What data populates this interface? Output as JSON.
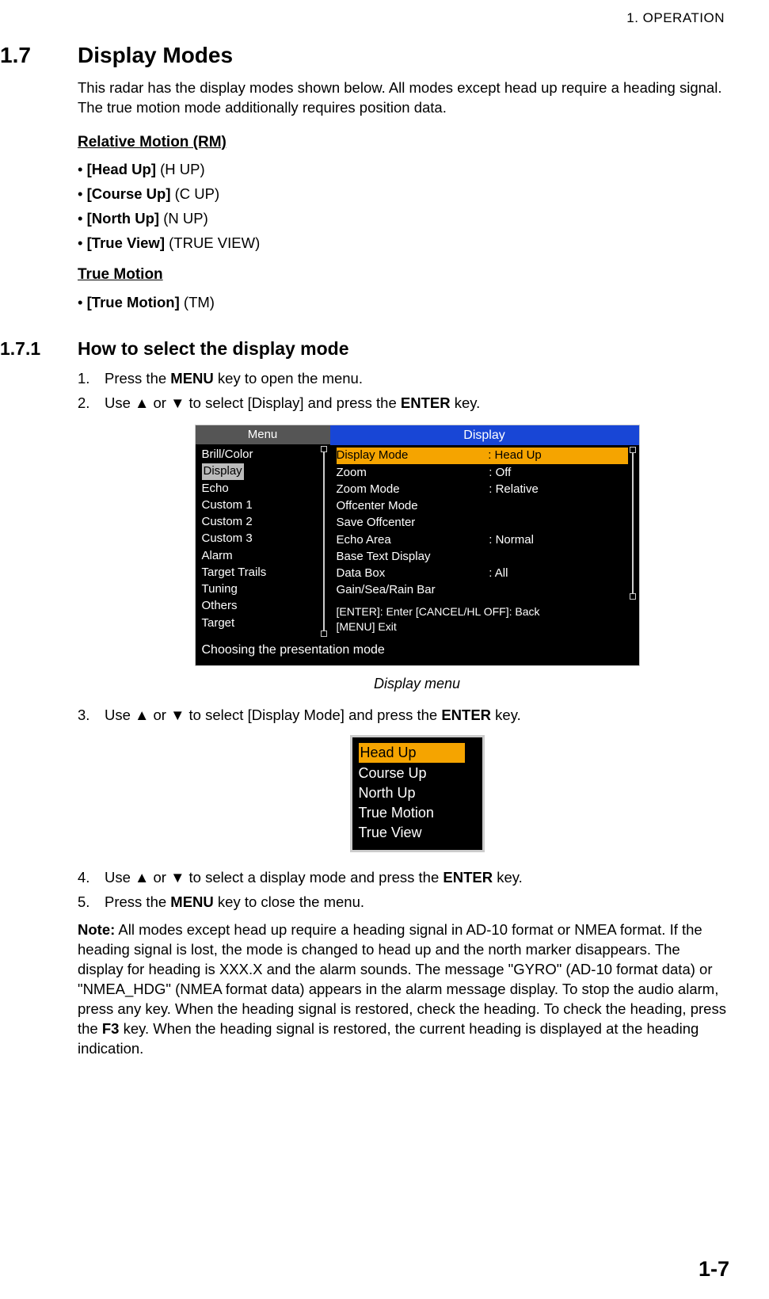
{
  "header": {
    "running": "1.  OPERATION",
    "page_number": "1-7"
  },
  "section": {
    "num": "1.7",
    "title": "Display Modes",
    "intro": "This radar has the display modes shown below. All modes except head up require a heading signal. The true motion mode additionally requires position data.",
    "rm_heading": "Relative Motion (RM)",
    "rm_items": [
      {
        "bold": "[Head Up]",
        "rest": " (H UP)"
      },
      {
        "bold": "[Course Up]",
        "rest": " (C UP)"
      },
      {
        "bold": "[North Up]",
        "rest": " (N UP)"
      },
      {
        "bold": "[True View]",
        "rest": " (TRUE VIEW)"
      }
    ],
    "tm_heading": "True Motion",
    "tm_items": [
      {
        "bold": "[True Motion]",
        "rest": " (TM)"
      }
    ]
  },
  "sub": {
    "num": "1.7.1",
    "title": "How to select the display mode",
    "step1_a": "Press the ",
    "step1_key": "MENU",
    "step1_b": " key to open the menu.",
    "step2_a": "Use ",
    "step2_b": " or ",
    "step2_c": " to select [Display] and press the ",
    "step2_key": "ENTER",
    "step2_d": " key.",
    "step3_a": "Use ",
    "step3_b": " or ",
    "step3_c": " to select [Display Mode] and press the ",
    "step3_key": "ENTER",
    "step3_d": " key.",
    "step4_a": "Use ",
    "step4_b": " or ",
    "step4_c": " to select a display mode and press the ",
    "step4_key": "ENTER",
    "step4_d": " key.",
    "step5_a": "Press the ",
    "step5_key": "MENU",
    "step5_b": " key to close the menu.",
    "note_label": "Note:",
    "note_a": " All modes except head up require a heading signal in AD-10 format or NMEA format. If the heading signal is lost, the mode is changed to head up and the north marker disappears. The display for heading is XXX.X and the alarm sounds. The mes­sage \"GYRO\" (AD-10 format data) or \"NMEA_HDG\" (NMEA format data) appears in the alarm message display. To stop the audio alarm, press any key. When the heading signal is restored, check the heading. To check the heading, press the ",
    "note_key": "F3",
    "note_b": " key. When the heading signal is restored, the current heading is displayed at the heading indica­tion."
  },
  "fig1": {
    "menu_title": "Menu",
    "disp_title": "Display",
    "menu_items": [
      "Brill/Color",
      "Display",
      "Echo",
      "Custom 1",
      "Custom 2",
      "Custom 3",
      "Alarm",
      "Target Trails",
      "Tuning",
      "Others",
      "Target"
    ],
    "menu_selected_index": 1,
    "disp_rows": [
      {
        "label": "Display Mode",
        "val": ": Head Up"
      },
      {
        "label": "Zoom",
        "val": ": Off"
      },
      {
        "label": "Zoom Mode",
        "val": ": Relative"
      },
      {
        "label": "Offcenter Mode",
        "val": ""
      },
      {
        "label": "Save Offcenter",
        "val": ""
      },
      {
        "label": "Echo Area",
        "val": ": Normal"
      },
      {
        "label": "Base Text Display",
        "val": ""
      },
      {
        "label": "Data Box",
        "val": ": All"
      },
      {
        "label": "Gain/Sea/Rain Bar",
        "val": ""
      }
    ],
    "footer1": "[ENTER]: Enter [CANCEL/HL OFF]: Back",
    "footer2": "[MENU] Exit",
    "status": "Choosing the presentation mode",
    "caption": "Display menu"
  },
  "fig2": {
    "options": [
      "Head Up",
      "Course Up",
      "North Up",
      "True Motion",
      "True View"
    ],
    "selected_index": 0
  }
}
